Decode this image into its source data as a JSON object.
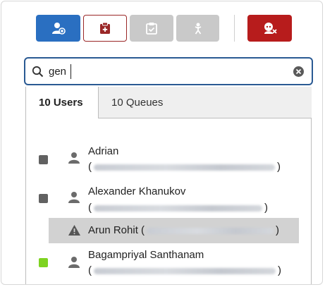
{
  "toolbar": {
    "buttons": [
      {
        "name": "add-participant",
        "icon": "person-add-icon",
        "color": "#2a6fc1",
        "enabled": true
      },
      {
        "name": "task",
        "icon": "clipboard-plus-icon",
        "color": "#9a2727",
        "enabled": true
      },
      {
        "name": "clipboard",
        "icon": "clipboard-check-icon",
        "color": "#c9c9c9",
        "enabled": false
      },
      {
        "name": "transfer",
        "icon": "person-transfer-icon",
        "color": "#c9c9c9",
        "enabled": false
      },
      {
        "name": "go-offline",
        "icon": "person-off-icon",
        "color": "#b71c1c",
        "enabled": true
      }
    ]
  },
  "search": {
    "value": "gen",
    "icon": "search-icon",
    "clear_icon": "clear-icon"
  },
  "tabs": [
    {
      "label": "10 Users",
      "active": true
    },
    {
      "label": "10 Queues",
      "active": false
    }
  ],
  "users": [
    {
      "name": "Adrian",
      "email_open": "(",
      "email_close": ")",
      "status_color": "#616161",
      "icon": "person-icon",
      "email_obscured": true
    },
    {
      "name": "Alexander Khanukov",
      "email_open": "(",
      "email_close": ")",
      "status_color": "#616161",
      "icon": "person-icon",
      "email_obscured": true
    },
    {
      "name": "Arun Rohit (",
      "email_close": ")",
      "status_color": null,
      "icon": "warning-icon",
      "highlighted": true,
      "email_obscured": true
    },
    {
      "name": "Bagampriyal Santhanam",
      "email_open": "(",
      "email_close": ")",
      "status_color": "#7ed321",
      "icon": "person-icon",
      "email_obscured": true
    }
  ]
}
